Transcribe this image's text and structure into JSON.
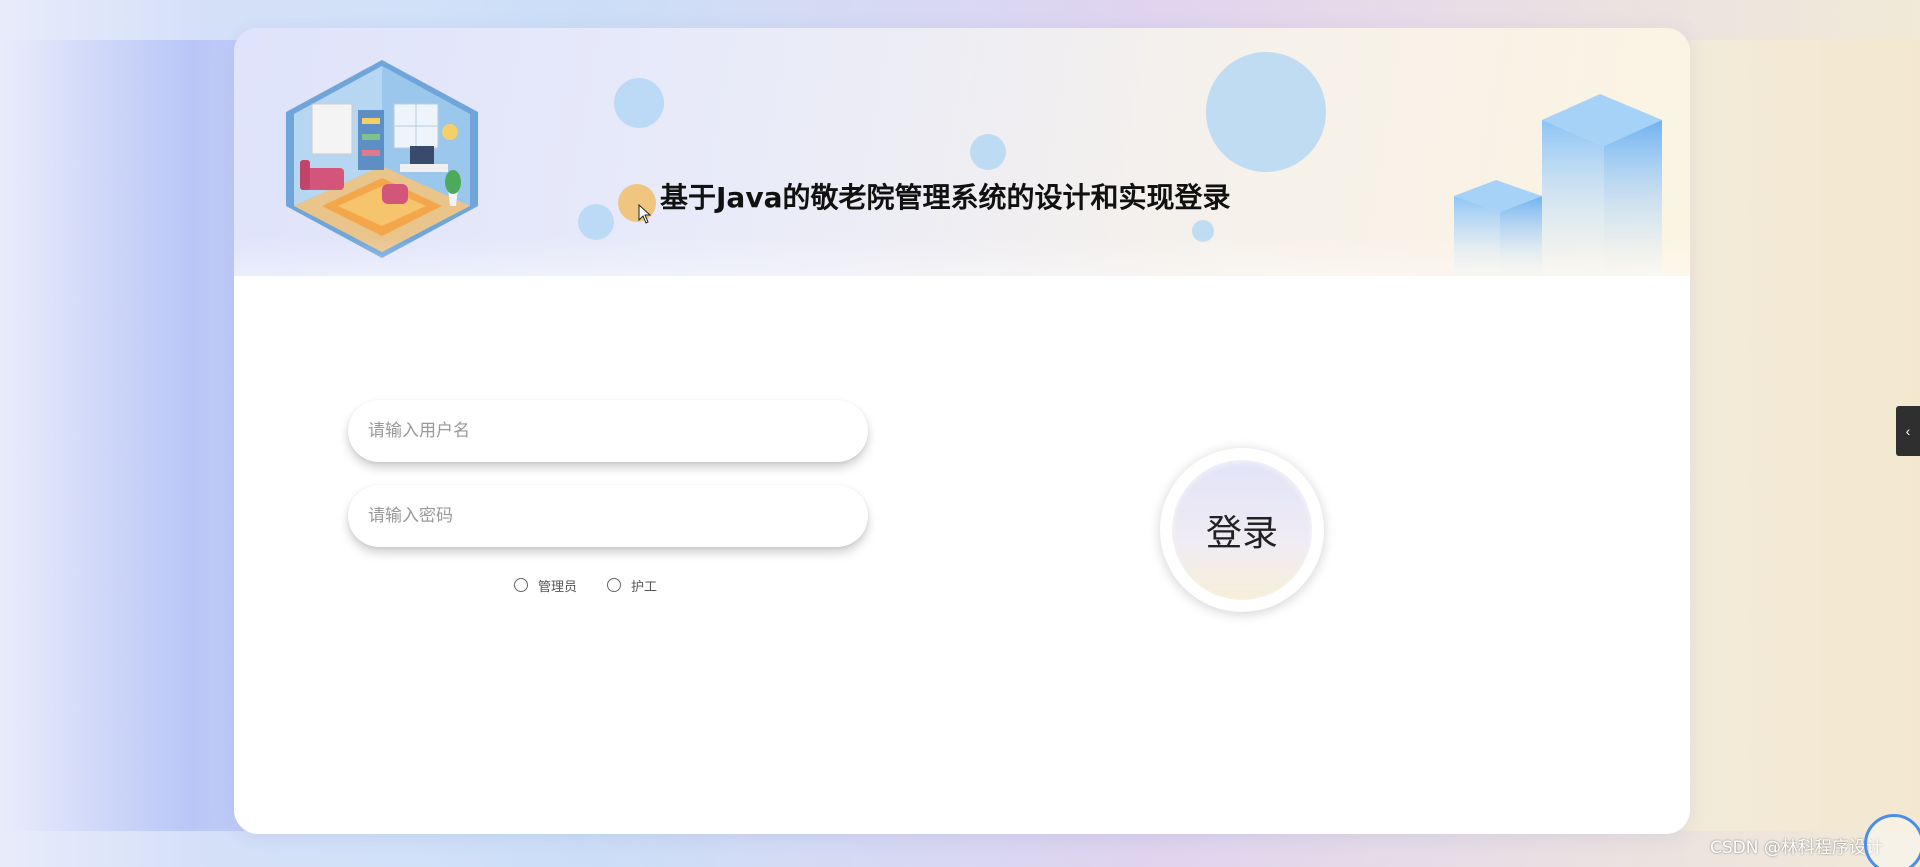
{
  "banner": {
    "title": "基于Java的敬老院管理系统的设计和实现登录"
  },
  "form": {
    "username_placeholder": "请输入用户名",
    "password_placeholder": "请输入密码",
    "roles": [
      {
        "label": "管理员",
        "selected": false
      },
      {
        "label": "护工",
        "selected": false
      }
    ]
  },
  "login": {
    "label": "登录"
  },
  "side_tab": {
    "icon": "chevron-left-icon",
    "glyph": "‹"
  },
  "watermark": {
    "text": "CSDN @林科程序设计"
  },
  "colors": {
    "bubble": "#a9d3f5",
    "accent": "#f1c172"
  }
}
